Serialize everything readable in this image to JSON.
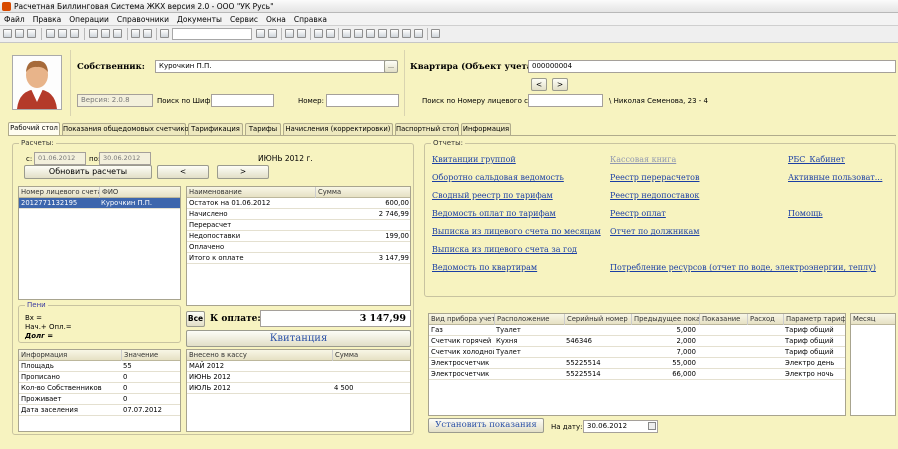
{
  "window": {
    "title": "Расчетная Биллинговая Система ЖКХ версия 2.0 - ООО \"УК Русь\""
  },
  "menu": [
    "Файл",
    "Правка",
    "Операции",
    "Справочники",
    "Документы",
    "Сервис",
    "Окна",
    "Справка"
  ],
  "owner": {
    "label": "Собственник:",
    "value": "Курочкин П.П.",
    "version": "Версия: 2.0.8",
    "search_cipher": "Поиск по Шифру:",
    "number_label": "Номер:"
  },
  "flat": {
    "label": "Квартира (Объект учета):",
    "value": "000000004",
    "search_account": "Поиск по Номеру лицевого счета:",
    "address": "\\ Николая Семенова, 23 - 4"
  },
  "tabs": [
    "Рабочий стол",
    "Показания общедомовых счетчиков",
    "Тарификация",
    "Тарифы",
    "Начисления (корректировки)",
    "Паспортный стол",
    "Информация"
  ],
  "calc": {
    "group": "Расчеты:",
    "from_label": "с:",
    "from": "01.06.2012",
    "to_label": "по:",
    "to": "30.06.2012",
    "refresh": "Обновить расчеты",
    "prev": "<",
    "next": ">",
    "month": "ИЮНЬ 2012 г.",
    "accounts_headers": [
      "Номер лицевого счета",
      "ФИО"
    ],
    "accounts": [
      {
        "num": "2012771132195",
        "name": "Курочкин П.П."
      }
    ],
    "charges_headers": [
      "Наименование",
      "Сумма"
    ],
    "charges": [
      {
        "name": "Остаток на 01.06.2012",
        "sum": "600,00"
      },
      {
        "name": "Начислено",
        "sum": "2 746,99"
      },
      {
        "name": "Перерасчет",
        "sum": ""
      },
      {
        "name": "Недопоставки",
        "sum": "199,00"
      },
      {
        "name": "Оплачено",
        "sum": ""
      },
      {
        "name": "Итого к оплате",
        "sum": "3 147,99"
      }
    ],
    "peni": "Пени",
    "vh": "Вх =",
    "nach_opl": "Нач.+ Опл.=",
    "debt": "Долг  =",
    "all": "Все",
    "to_pay_label": "К оплате:",
    "to_pay": "3 147,99",
    "receipt": "Квитанция",
    "info_headers": [
      "Информация",
      "Значение"
    ],
    "info": [
      {
        "k": "Площадь",
        "v": "55"
      },
      {
        "k": "Прописано",
        "v": "0"
      },
      {
        "k": "Кол-во Собственников",
        "v": "0"
      },
      {
        "k": "Проживает",
        "v": "0"
      },
      {
        "k": "Дата заселения",
        "v": "07.07.2012"
      }
    ],
    "cash_headers": [
      "Внесено в кассу",
      "Сумма"
    ],
    "cash": [
      {
        "k": "МАЙ 2012",
        "v": ""
      },
      {
        "k": "ИЮНЬ 2012",
        "v": ""
      },
      {
        "k": "ИЮЛЬ 2012",
        "v": "4 500"
      }
    ]
  },
  "reports": {
    "group": "Отчеты:",
    "col1": [
      "Квитанции группой",
      "Оборотно сальдовая ведомость",
      "Сводный реестр по тарифам",
      "Ведомость оплат по тарифам",
      "Выписка из лицевого счета по месяцам",
      "Выписка из лицевого счета за год",
      "Ведомость по квартирам"
    ],
    "col2": [
      "Кассовая книга",
      "Реестр перерасчетов",
      "Реестр недопоставок",
      "Реестр оплат",
      "Отчет по должникам",
      "Потребление ресурсов (отчет по воде, электроэнергии, теплу)"
    ],
    "col3": [
      "РБС_Кабинет",
      "Активные пользоват...",
      "Помощь"
    ]
  },
  "meters": {
    "headers": [
      "Вид прибора учета",
      "Расположение",
      "Серийный номер",
      "Предыдущее пока...",
      "Показание",
      "Расход",
      "Параметр тарифи..."
    ],
    "rows": [
      {
        "type": "Газ",
        "loc": "Туалет",
        "serial": "",
        "prev": "5,000",
        "cur": "",
        "use": "",
        "tariff": "Тариф общий"
      },
      {
        "type": "Счетчик горячей в...",
        "loc": "Кухня",
        "serial": "546346",
        "prev": "2,000",
        "cur": "",
        "use": "",
        "tariff": "Тариф общий"
      },
      {
        "type": "Счетчик холодной ...",
        "loc": "Туалет",
        "serial": "",
        "prev": "7,000",
        "cur": "",
        "use": "",
        "tariff": "Тариф общий"
      },
      {
        "type": "Электросчетчик",
        "loc": "",
        "serial": "55225514",
        "prev": "55,000",
        "cur": "",
        "use": "",
        "tariff": "Электро день"
      },
      {
        "type": "Электросчетчик",
        "loc": "",
        "serial": "55225514",
        "prev": "66,000",
        "cur": "",
        "use": "",
        "tariff": "Электро ночь"
      }
    ],
    "month_header": "Месяц",
    "set_btn": "Установить показания",
    "date_label": "На дату:",
    "date": "30.06.2012"
  }
}
